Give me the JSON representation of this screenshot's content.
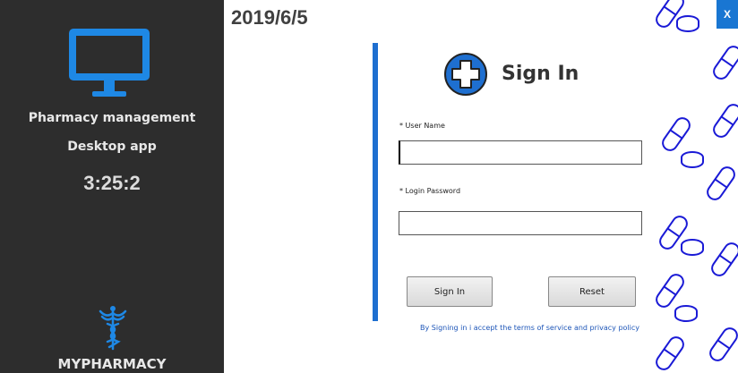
{
  "sidebar": {
    "title_line1": "Pharmacy management",
    "title_line2": "Desktop app",
    "clock": "3:25:2",
    "brand": "MYPHARMACY",
    "icons": [
      "monitor-icon",
      "caduceus-icon"
    ]
  },
  "header": {
    "date": "2019/6/5",
    "close_label": "X"
  },
  "form": {
    "title": "Sign In",
    "icon": "medical-cross-icon",
    "username_label": "* User Name",
    "username_value": "",
    "password_label": "* Login Password",
    "password_value": "",
    "signin_button": "Sign In",
    "reset_button": "Reset",
    "terms": "By Signing in i accept the terms of service and privacy policy"
  },
  "colors": {
    "sidebar_bg": "#2d2d2d",
    "accent": "#1e6fd0",
    "icon_blue": "#1e88e5",
    "close_button": "#1976d2",
    "pill_outline": "#1a1ad6"
  },
  "decoration": {
    "pattern_icon": "pill-capsule-icon"
  }
}
